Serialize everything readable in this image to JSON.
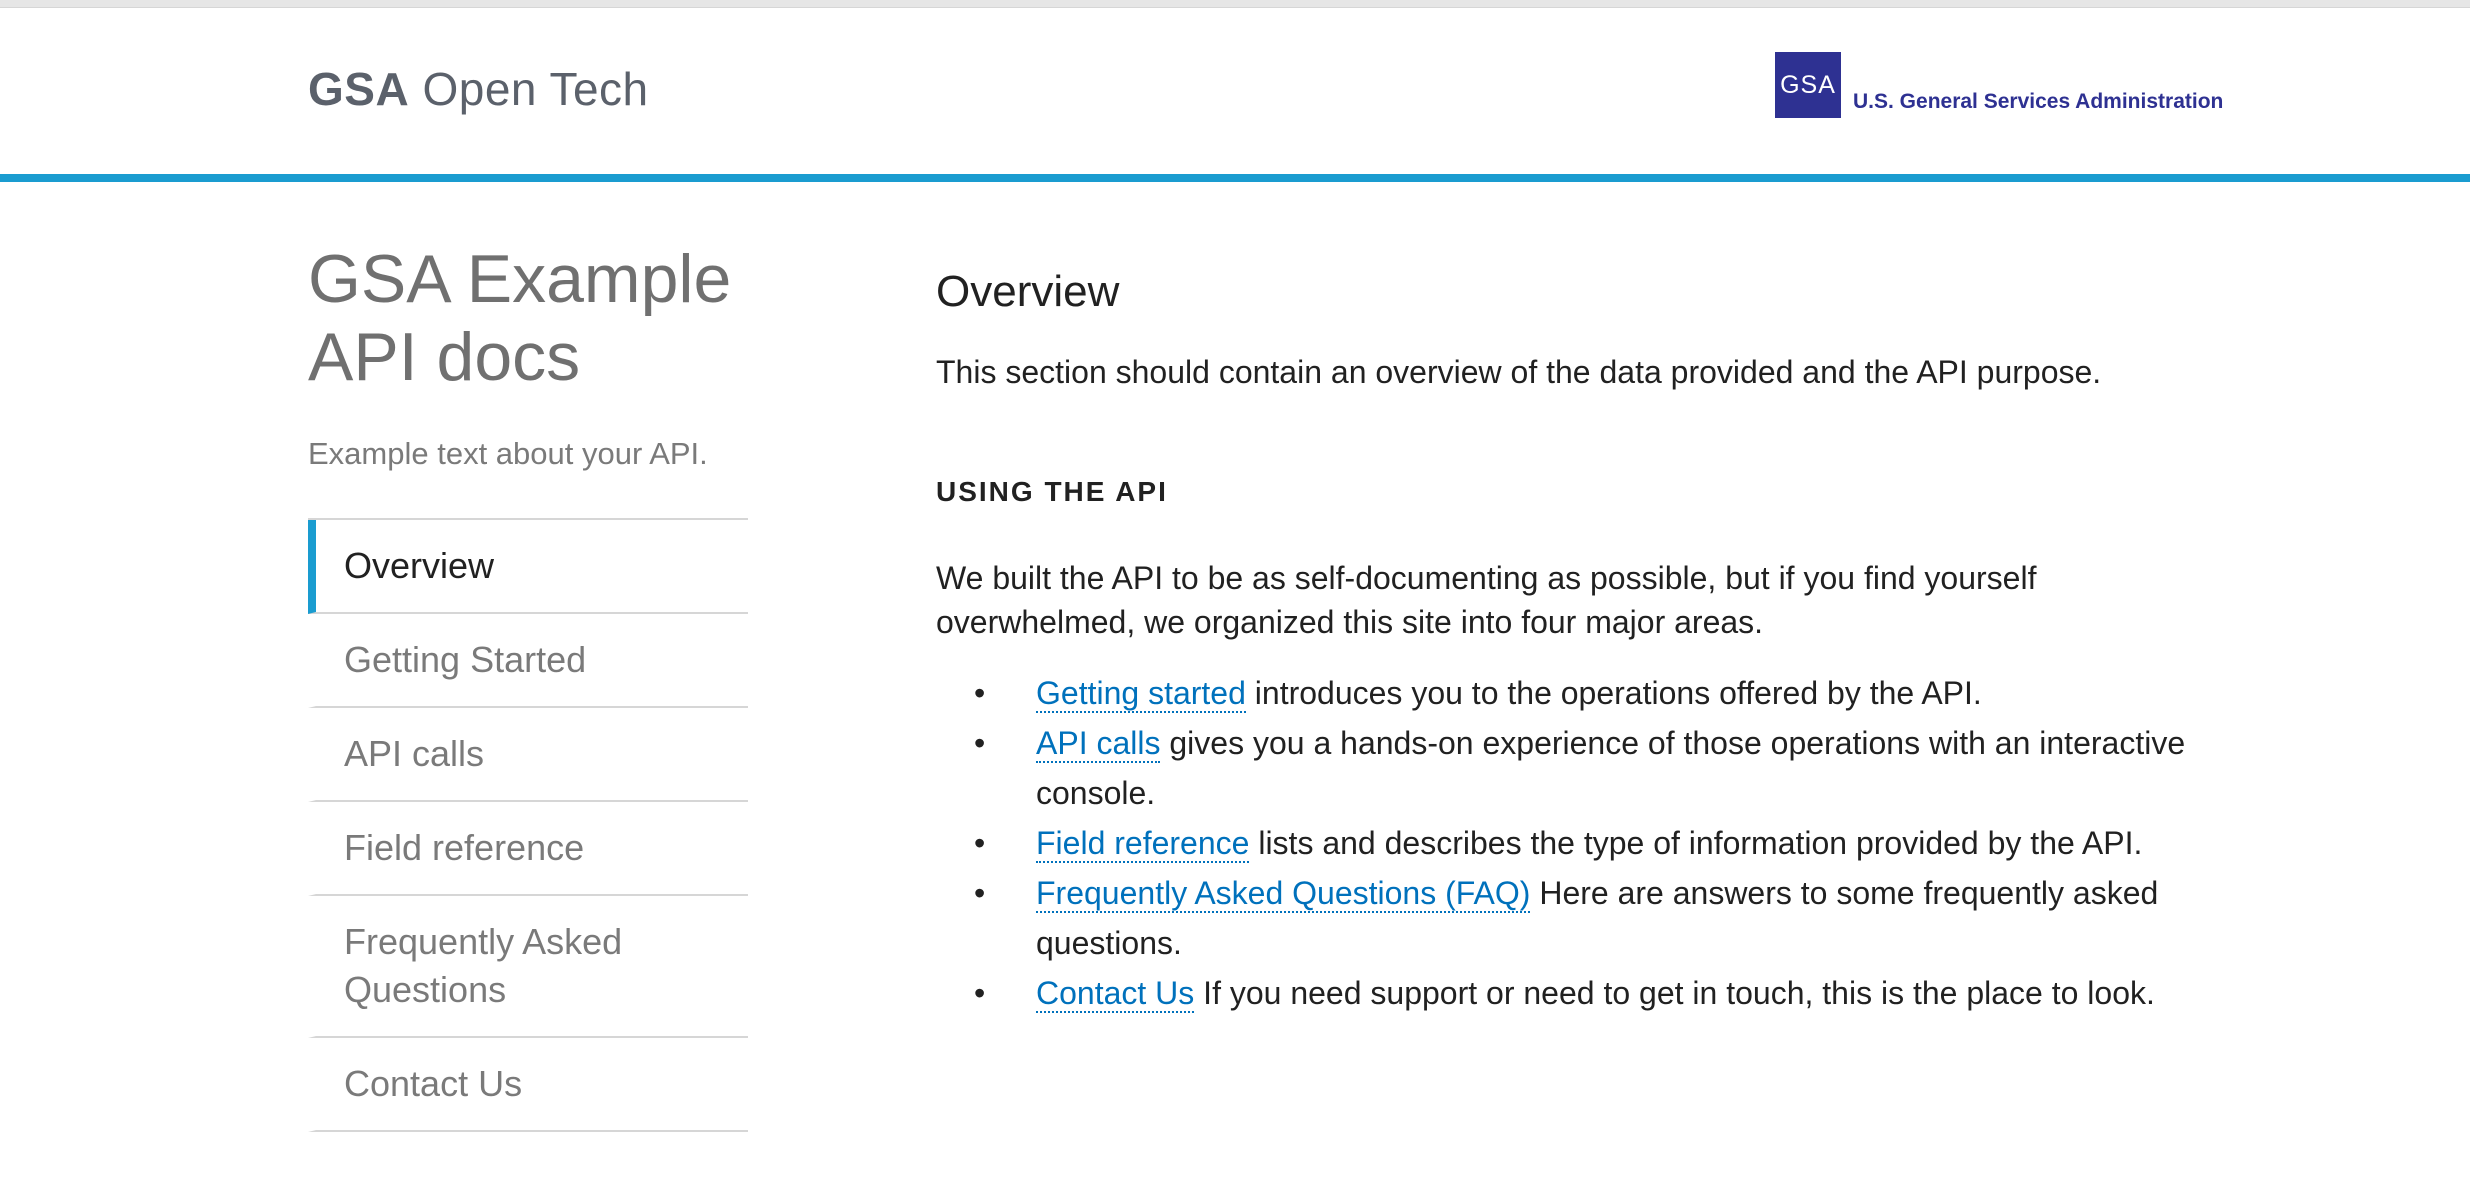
{
  "header": {
    "brand_strong": "GSA",
    "brand_light": "Open Tech",
    "logo_mark": "GSA",
    "logo_name": "U.S. General Services Administration"
  },
  "sidebar": {
    "title_line1": "GSA Example",
    "title_line2": "API docs",
    "description": "Example text about your API.",
    "items": [
      {
        "label": "Overview",
        "active": true
      },
      {
        "label": "Getting Started",
        "active": false
      },
      {
        "label": "API calls",
        "active": false
      },
      {
        "label": "Field reference",
        "active": false
      },
      {
        "label": "Frequently Asked Questions",
        "active": false
      },
      {
        "label": "Contact Us",
        "active": false
      }
    ]
  },
  "main": {
    "heading": "Overview",
    "overview_text": "This section should contain an overview of the data provided and the API purpose.",
    "section_heading": "USING THE API",
    "intro_text": "We built the API to be as self-documenting as possible, but if you find yourself overwhelmed, we organized this site into four major areas.",
    "areas": [
      {
        "link": "Getting started",
        "text": " introduces you to the operations offered by the API."
      },
      {
        "link": "API calls",
        "text": " gives you a hands-on experience of those operations with an interactive console."
      },
      {
        "link": "Field reference",
        "text": " lists and describes the type of information provided by the API."
      },
      {
        "link": "Frequently Asked Questions (FAQ)",
        "text": " Here are answers to some frequently asked questions."
      },
      {
        "link": "Contact Us",
        "text": " If you need support or need to get in touch, this is the place to look."
      }
    ]
  },
  "colors": {
    "accent": "#1a9cd0",
    "link": "#0071bc",
    "gsa_blue": "#2e3192"
  }
}
